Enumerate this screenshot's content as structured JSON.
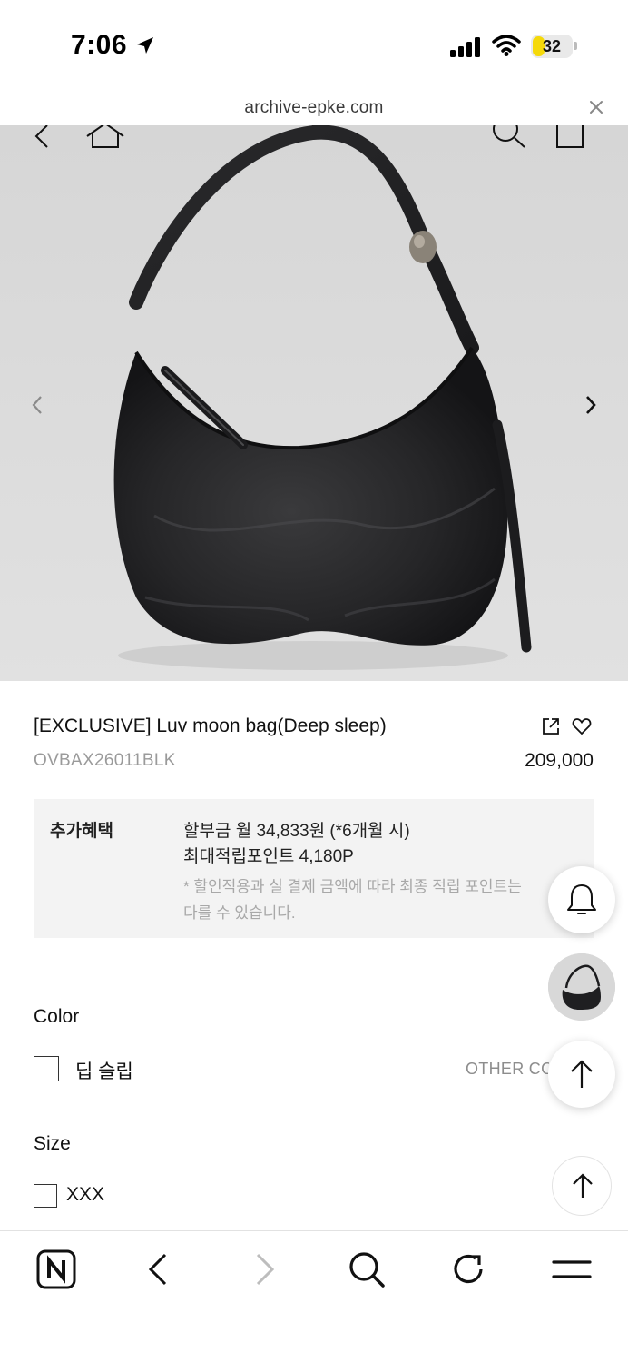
{
  "status_bar": {
    "time": "7:06",
    "battery_level": "32",
    "battery_fraction": 0.32,
    "icons": [
      "location-arrow-icon",
      "cellular-signal-icon",
      "wifi-icon",
      "battery-icon"
    ]
  },
  "browser": {
    "url": "archive-epke.com",
    "close_icon": "close-icon"
  },
  "gallery": {
    "top_icons": [
      "back-chevron-icon",
      "home-icon",
      "search-icon",
      "shopping-bag-icon"
    ],
    "prev_icon": "chevron-left-icon",
    "next_icon": "chevron-right-icon"
  },
  "product": {
    "name": "[EXCLUSIVE] Luv moon bag(Deep sleep)",
    "code": "OVBAX26011BLK",
    "price": "209,000",
    "share_icon": "share-icon",
    "wishlist_icon": "heart-icon"
  },
  "benefits": {
    "label": "추가혜택",
    "installment": "할부금 월 34,833원 (*6개월 시)",
    "points": "최대적립포인트 4,180P",
    "note": "* 할인적용과 실 결제 금액에 따라 최종 적립 포인트는 다를 수 있습니다."
  },
  "options": {
    "color_title": "Color",
    "color_option": "딥 슬립",
    "other_colors": "OTHER COLORS",
    "size_title": "Size",
    "size_option": "XXX"
  },
  "floating": {
    "notify_icon": "bell-icon",
    "thumbnail": "product-thumbnail",
    "scroll_top_icon": "arrow-up-icon"
  },
  "toolbar": {
    "icons": [
      "naver-logo-icon",
      "back-arrow-icon",
      "forward-arrow-icon",
      "search-icon",
      "refresh-icon",
      "menu-icon"
    ]
  }
}
